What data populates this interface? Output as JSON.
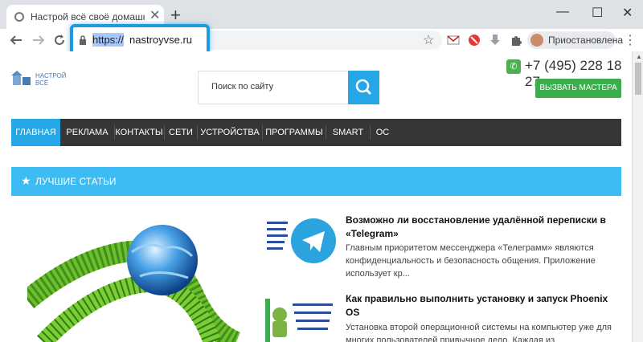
{
  "browser": {
    "tab_title": "Настрой всё своё домашнее об",
    "tab_close": "✕",
    "new_tab": "+",
    "url_protocol": "https://",
    "url_host": "nastroyvse.ru",
    "profile_label": "Приостановлена",
    "window_controls": [
      "—",
      "☐",
      "✕"
    ],
    "nav_icons": [
      "arrow-left-icon",
      "arrow-right-icon",
      "reload-icon"
    ],
    "star": "☆",
    "menu": "⋮"
  },
  "site": {
    "logo_text_line1": "НАСТРОЙ",
    "logo_text_line2": "ВСЁ",
    "search_placeholder": "Поиск по сайту",
    "phone": "+7 (495) 228 18 27",
    "phone_icon_glyph": "✆",
    "master_button": "ВЫЗВАТЬ МАСТЕРА",
    "nav": [
      "ГЛАВНАЯ",
      "РЕКЛАМА",
      "КОНТАКТЫ",
      "СЕТИ",
      "УСТРОЙСТВА",
      "ПРОГРАММЫ",
      "SMART TV",
      "ОС"
    ],
    "best_title": "ЛУЧШИЕ СТАТЬИ",
    "best_star": "★",
    "articles": [
      {
        "title": "Возможно ли восстановление удалённой переписки в «Telegram»",
        "text": "Главным приоритетом мессенджера «Телеграмм» являются конфиденциальность и безопасность общения. Приложение использует кр..."
      },
      {
        "title": "Как правильно выполнить установку и запуск Phoenix OS",
        "text": "Установка второй операционной системы на компьютер уже для многих пользователей привычное дело. Каждая из"
      }
    ]
  },
  "colors": {
    "accent": "#25a7e7",
    "highlight_border": "#1e9be0",
    "nav_bg": "#363636",
    "best_bar": "#3dbbf3",
    "master_btn": "#3cad4d"
  }
}
